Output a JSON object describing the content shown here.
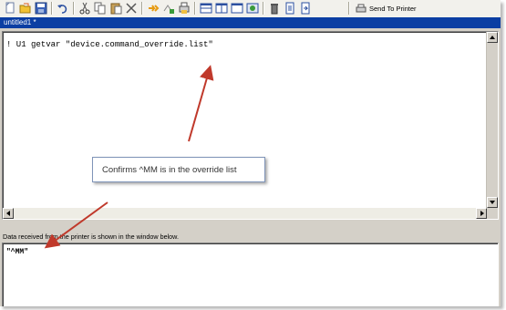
{
  "toolbar": {
    "buttons": [
      "new-file-icon",
      "open-folder-icon",
      "save-icon",
      "undo-icon",
      "cut-icon",
      "copy-icon",
      "paste-icon",
      "delete-icon",
      "find-icon",
      "replace-icon",
      "printer-settings-icon",
      "split-horizontal-icon",
      "split-vertical-icon",
      "window-icon",
      "app-icon",
      "trash-icon",
      "page-icon",
      "page-arrow-icon"
    ],
    "send_label": "Send To Printer"
  },
  "document": {
    "title": "untitled1 *"
  },
  "editor": {
    "command": "! U1 getvar \"device.command_override.list\""
  },
  "output": {
    "label": "Data received from the printer is shown in the window below.",
    "value": "\"^MM\""
  },
  "annotation": {
    "callout_text": "Confirms ^MM is in the override list",
    "arrow_color": "#c0392b"
  },
  "colors": {
    "titlebar": "#0b3ea3",
    "frame": "#d4d0c8"
  }
}
